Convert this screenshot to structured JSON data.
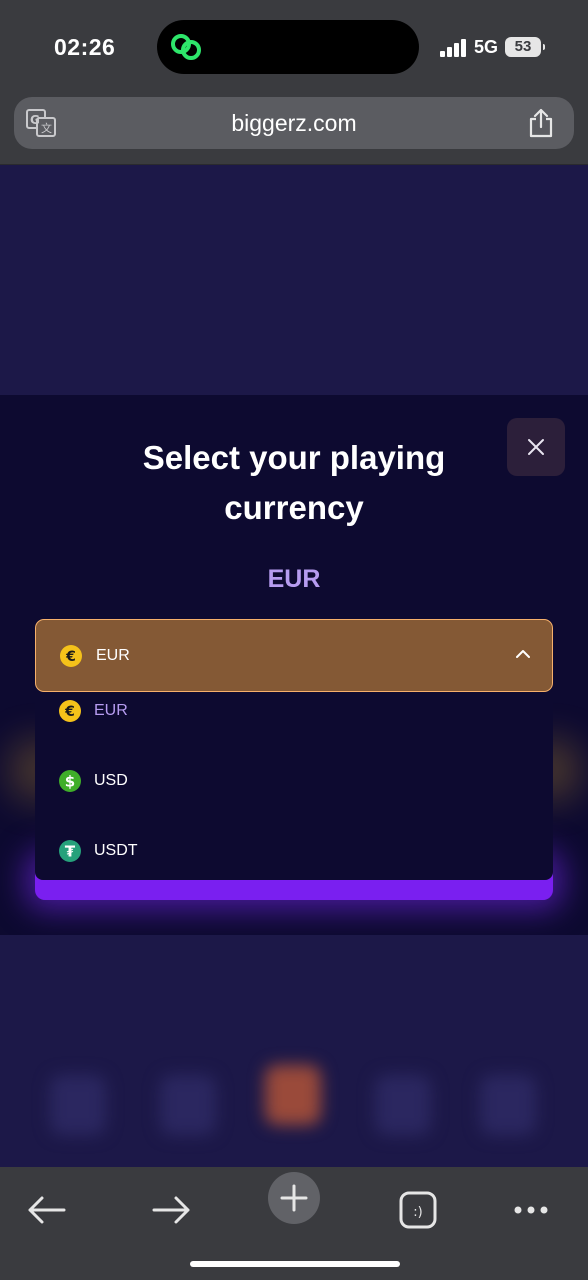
{
  "status_bar": {
    "time": "02:26",
    "network": "5G",
    "battery": "53"
  },
  "browser": {
    "url": "biggerz.com"
  },
  "modal": {
    "title_line1": "Select your playing",
    "title_line2": "currency",
    "selected_currency": "EUR"
  },
  "dropdown": {
    "selected": {
      "label": "EUR",
      "symbol": "€"
    },
    "options": [
      {
        "label": "EUR",
        "symbol": "€",
        "active": true
      },
      {
        "label": "USD",
        "symbol": "$",
        "active": false
      },
      {
        "label": "USDT",
        "symbol": "₮",
        "active": false
      }
    ]
  },
  "colors": {
    "page_bg": "#1c1848",
    "modal_bg": "#0d0a30",
    "dropdown_bg": "#845935",
    "dropdown_border": "#f6b06b",
    "accent_purple": "#b69cf0",
    "eur_coin": "#f5c21a",
    "usd_coin": "#3fae29",
    "usdt_coin": "#26a17b"
  },
  "icons": [
    "link-icon",
    "signal-icon",
    "translate-icon",
    "share-icon",
    "close-icon",
    "euro-coin-icon",
    "dollar-coin-icon",
    "tether-coin-icon",
    "chevron-up-icon",
    "back-arrow-icon",
    "forward-arrow-icon",
    "plus-icon",
    "tabs-icon",
    "more-icon"
  ]
}
